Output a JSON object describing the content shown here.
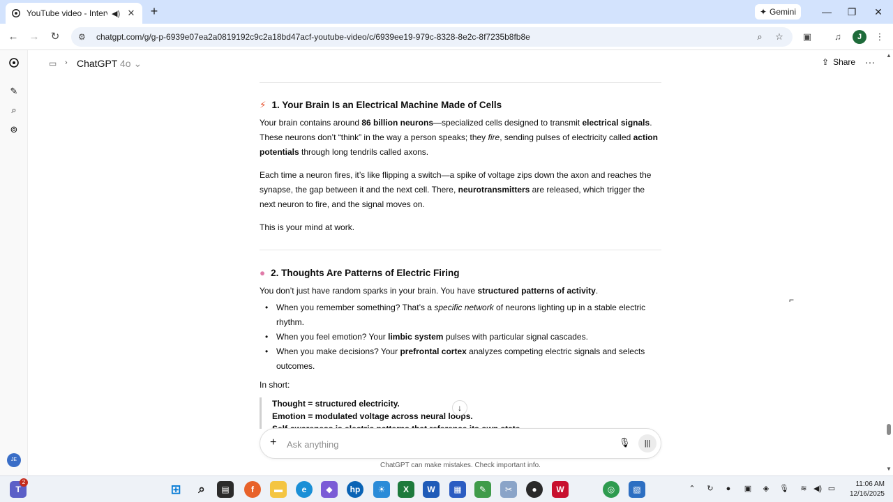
{
  "browser": {
    "tab_title": "YouTube video - Interview",
    "gemini_label": "Gemini",
    "url": "chatgpt.com/g/g-p-6939e07ea2a0819192c9c2a18bd47acf-youtube-video/c/6939ee19-979c-8328-8e2c-8f7235b8fb8e",
    "profile_initial": "J"
  },
  "header": {
    "model_name": "ChatGPT",
    "model_version": "4o",
    "share_label": "Share"
  },
  "sidebar": {
    "avatar_initials": "JE"
  },
  "article": {
    "section1": {
      "title": "1. Your Brain Is an Electrical Machine Made of Cells",
      "p1": {
        "t1": "Your brain contains around ",
        "b1": "86 billion neurons",
        "t2": "—specialized cells designed to transmit ",
        "b2": "electrical signals",
        "t3": ". These neurons don’t “think” in the way a person speaks; they ",
        "i1": "fire",
        "t4": ", sending pulses of electricity called ",
        "b3": "action potentials",
        "t5": " through long tendrils called axons."
      },
      "p2": {
        "t1": "Each time a neuron fires, it’s like flipping a switch—a spike of voltage zips down the axon and reaches the synapse, the gap between it and the next cell. There, ",
        "b1": "neurotransmitters",
        "t2": " are released, which trigger the next neuron to fire, and the signal moves on."
      },
      "p3": "This is your mind at work."
    },
    "section2": {
      "title": "2. Thoughts Are Patterns of Electric Firing",
      "intro": {
        "t1": "You don’t just have random sparks in your brain. You have ",
        "b1": "structured patterns of activity",
        "t2": "."
      },
      "bullets": [
        {
          "t1": "When you remember something? That’s a ",
          "i1": "specific network",
          "t2": " of neurons lighting up in a stable electric rhythm."
        },
        {
          "t1": "When you feel emotion? Your ",
          "b1": "limbic system",
          "t2": " pulses with particular signal cascades."
        },
        {
          "t1": "When you make decisions? Your ",
          "b1": "prefrontal cortex",
          "t2": " analyzes competing electric signals and selects outcomes."
        }
      ],
      "in_short": "In short:",
      "quote_lines": [
        "Thought = structured electricity.",
        "Emotion = modulated voltage across neural loops.",
        "Self-awareness is electric patterns that reference its own state."
      ]
    }
  },
  "composer": {
    "placeholder": "Ask anything",
    "disclaimer": "ChatGPT can make mistakes. Check important info."
  },
  "taskbar": {
    "notification_count": "2",
    "time": "11:06 AM",
    "date": "12/16/2025"
  },
  "colors": {
    "tabbar_bg": "#d3e3fd",
    "omnibox_bg": "#edf2fa",
    "taskbar_bg": "#eef2f7",
    "text": "#0d0d0d"
  }
}
